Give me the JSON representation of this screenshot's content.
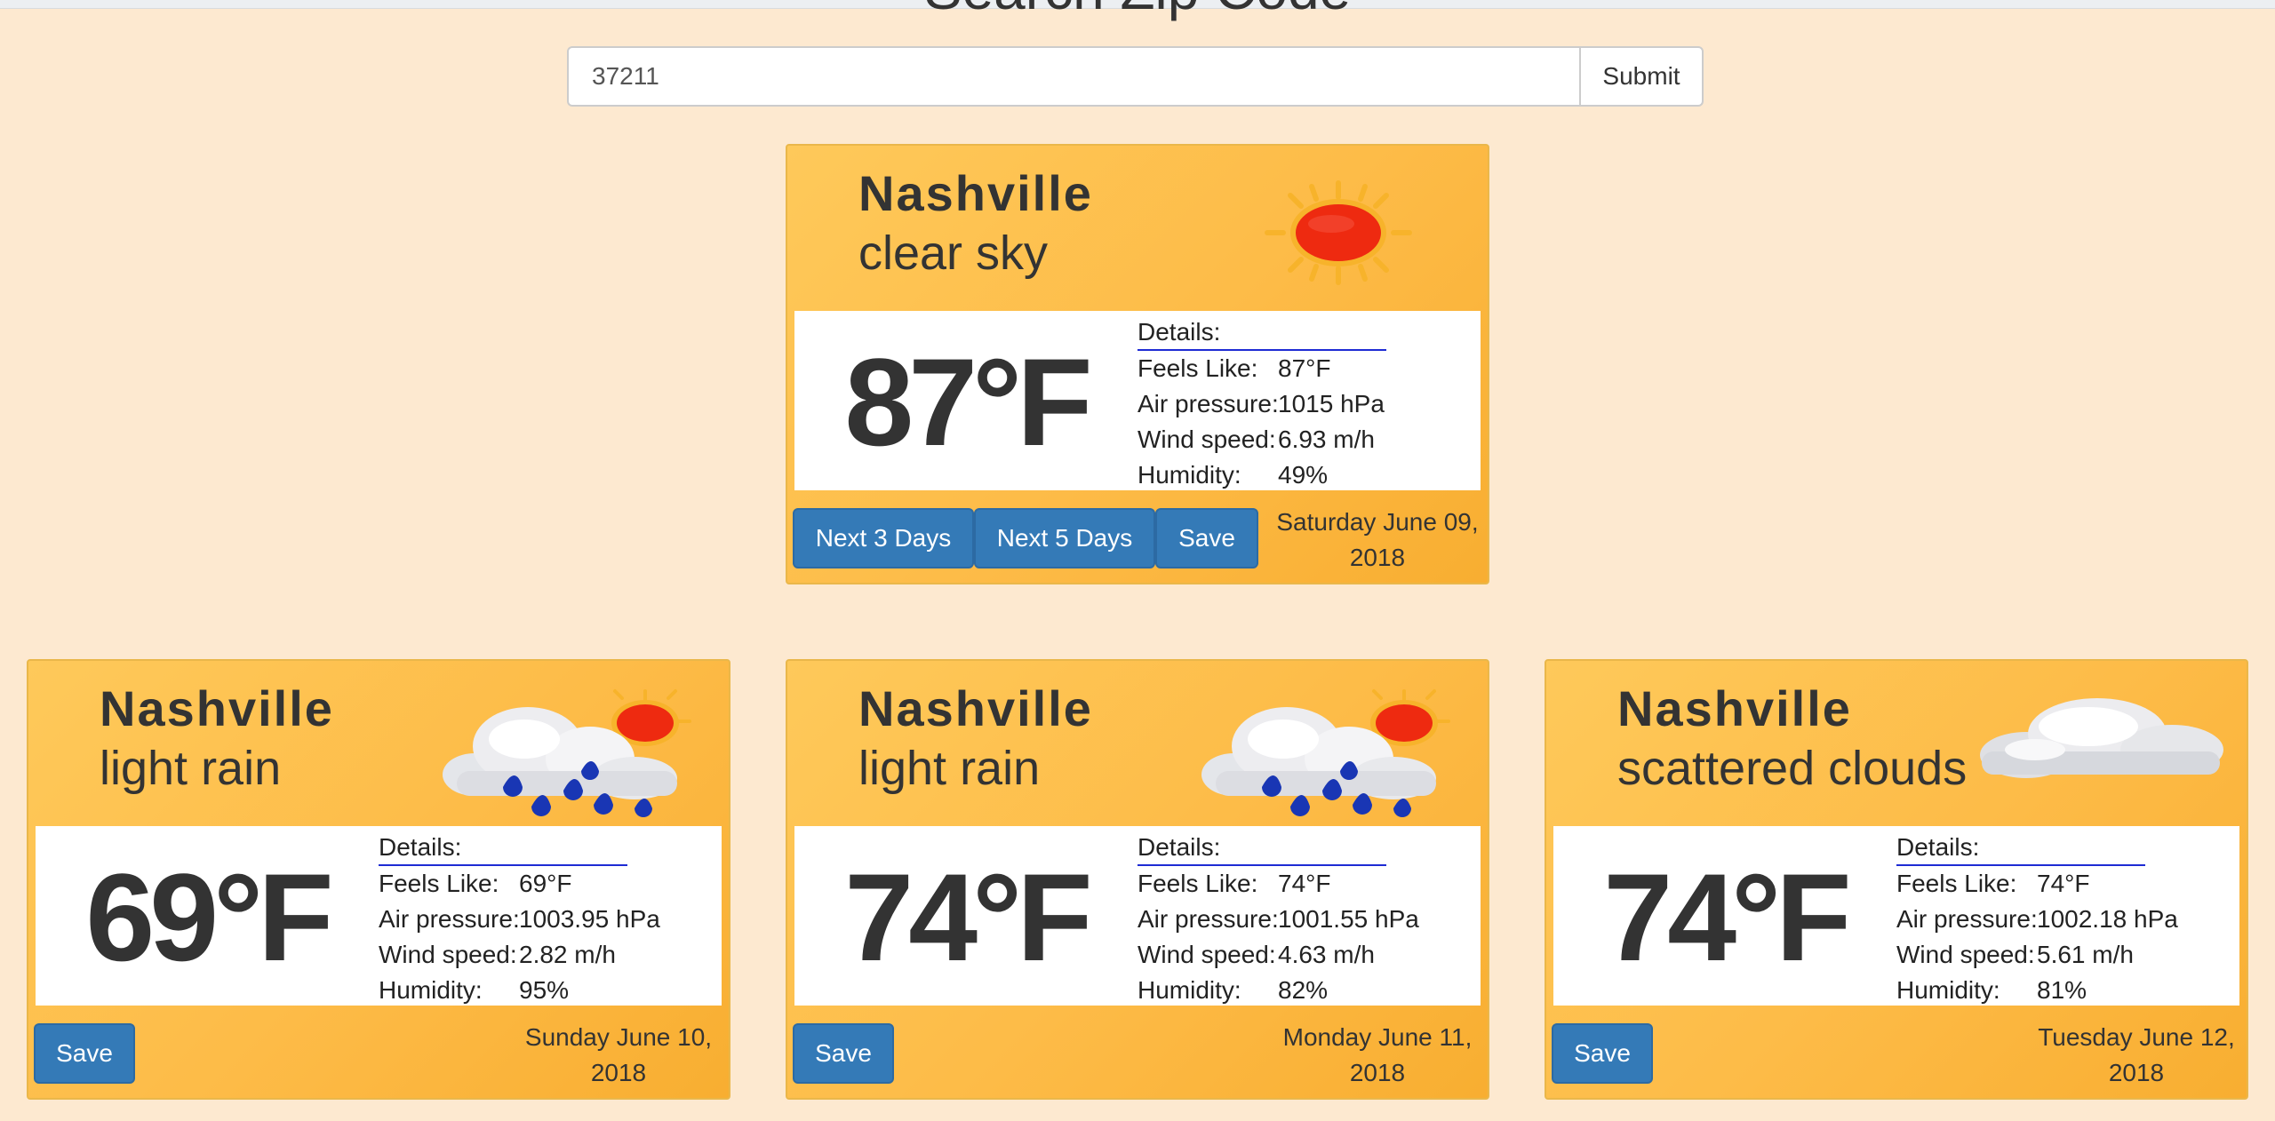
{
  "page": {
    "title": "Search Zip Code"
  },
  "search": {
    "value": "37211",
    "submit_label": "Submit"
  },
  "current": {
    "city": "Nashville",
    "description": "clear sky",
    "icon": "sun-icon",
    "temp": "87°F",
    "details": {
      "heading": "Details:",
      "feels_label": "Feels Like:",
      "feels": "87°F",
      "pressure_label": "Air pressure:",
      "pressure": "1015 hPa",
      "wind_label": "Wind speed:",
      "wind": "6.93 m/h",
      "humidity_label": "Humidity:",
      "humidity": "49%"
    },
    "buttons": {
      "next3": "Next 3 Days",
      "next5": "Next 5 Days",
      "save": "Save"
    },
    "date": "Saturday June 09, 2018"
  },
  "forecast": [
    {
      "city": "Nashville",
      "description": "light rain",
      "icon": "rain-icon",
      "temp": "69°F",
      "details": {
        "heading": "Details:",
        "feels_label": "Feels Like:",
        "feels": "69°F",
        "pressure_label": "Air pressure:",
        "pressure": "1003.95 hPa",
        "wind_label": "Wind speed:",
        "wind": "2.82 m/h",
        "humidity_label": "Humidity:",
        "humidity": "95%"
      },
      "save": "Save",
      "date": "Sunday June 10, 2018"
    },
    {
      "city": "Nashville",
      "description": "light rain",
      "icon": "rain-icon",
      "temp": "74°F",
      "details": {
        "heading": "Details:",
        "feels_label": "Feels Like:",
        "feels": "74°F",
        "pressure_label": "Air pressure:",
        "pressure": "1001.55 hPa",
        "wind_label": "Wind speed:",
        "wind": "4.63 m/h",
        "humidity_label": "Humidity:",
        "humidity": "82%"
      },
      "save": "Save",
      "date": "Monday June 11, 2018"
    },
    {
      "city": "Nashville",
      "description": "scattered clouds",
      "icon": "cloud-icon",
      "temp": "74°F",
      "details": {
        "heading": "Details:",
        "feels_label": "Feels Like:",
        "feels": "74°F",
        "pressure_label": "Air pressure:",
        "pressure": "1002.18 hPa",
        "wind_label": "Wind speed:",
        "wind": "5.61 m/h",
        "humidity_label": "Humidity:",
        "humidity": "81%"
      },
      "save": "Save",
      "date": "Tuesday June 12, 2018"
    }
  ]
}
